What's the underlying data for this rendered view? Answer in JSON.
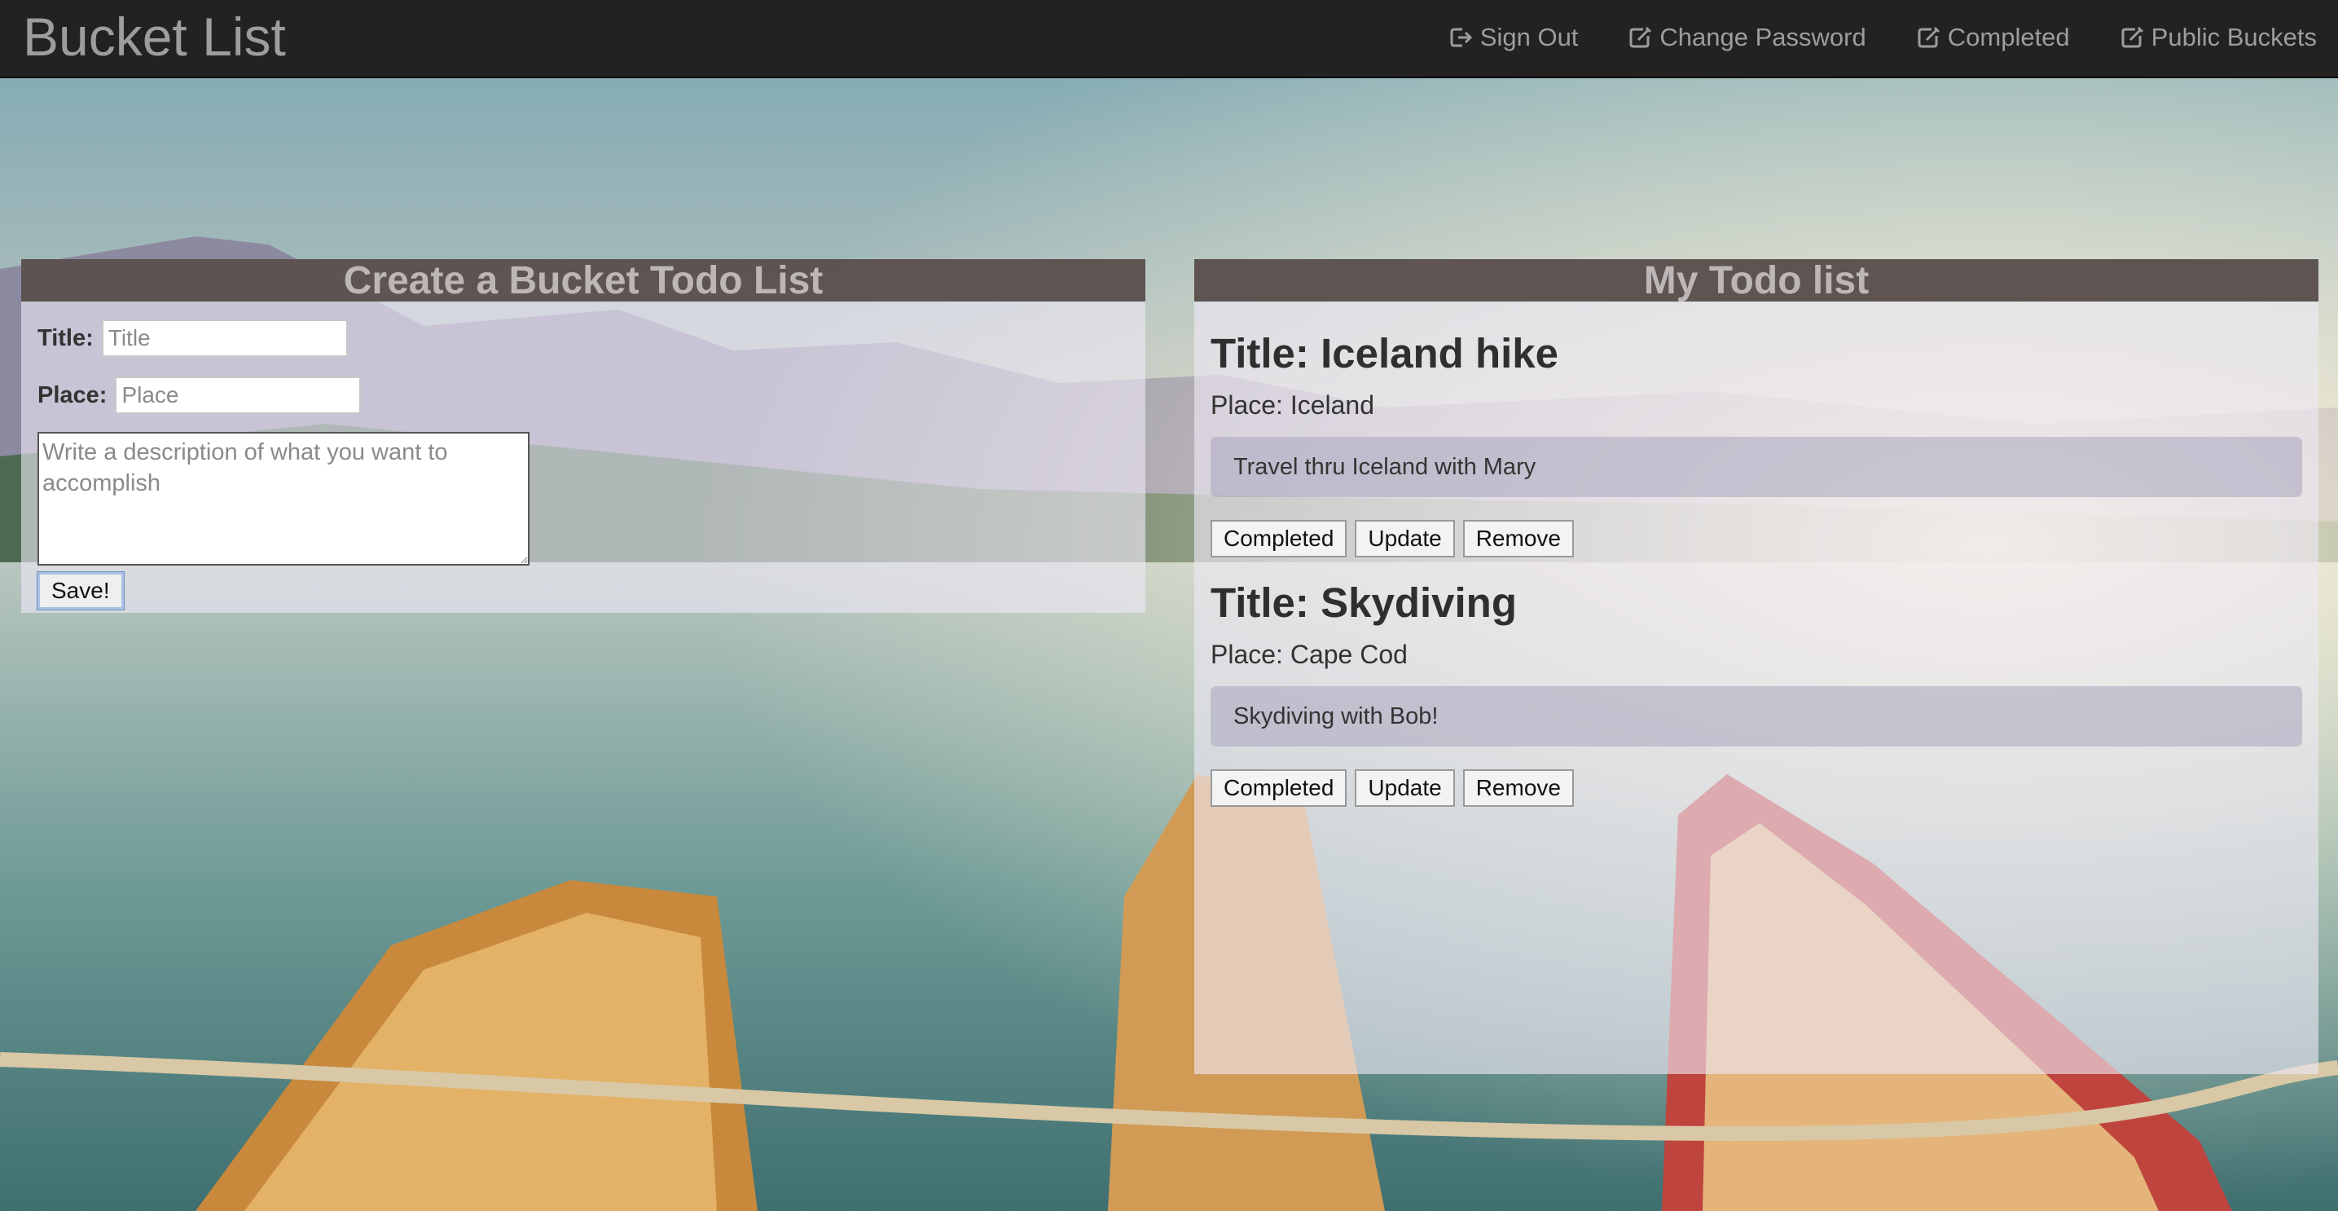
{
  "app": {
    "brand": "Bucket List"
  },
  "nav": {
    "items": [
      {
        "label": "Sign Out",
        "icon": "sign-out-icon"
      },
      {
        "label": "Change Password",
        "icon": "edit-icon"
      },
      {
        "label": "Completed",
        "icon": "edit-icon"
      },
      {
        "label": "Public Buckets",
        "icon": "edit-icon"
      }
    ]
  },
  "create": {
    "heading": "Create a Bucket Todo List",
    "title_label": "Title:",
    "title_placeholder": "Title",
    "place_label": "Place:",
    "place_placeholder": "Place",
    "description_placeholder": "Write a description of what you want to accomplish",
    "save_label": "Save!"
  },
  "todo": {
    "heading": "My Todo list",
    "items": [
      {
        "title": "Title: Iceland hike",
        "place": "Place: Iceland",
        "description": "Travel thru Iceland with Mary",
        "completed_label": "Completed",
        "update_label": "Update",
        "remove_label": "Remove"
      },
      {
        "title": "Title: Skydiving",
        "place": "Place: Cape Cod",
        "description": "Skydiving with Bob!",
        "completed_label": "Completed",
        "update_label": "Update",
        "remove_label": "Remove"
      }
    ]
  }
}
